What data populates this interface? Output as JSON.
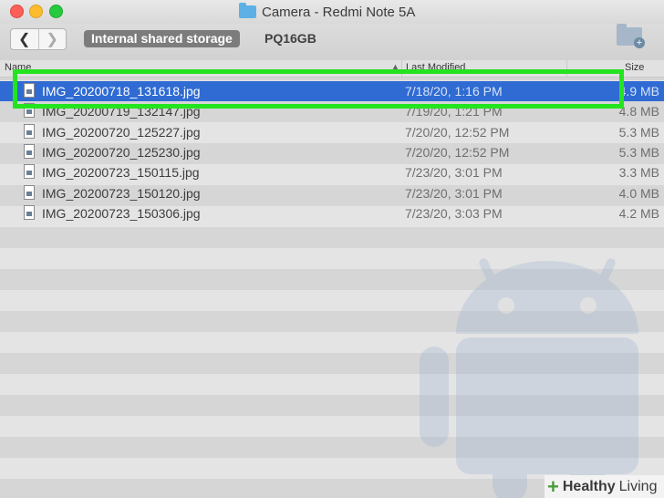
{
  "window": {
    "title": "Camera - Redmi Note 5A",
    "folder_icon": "folder-icon"
  },
  "toolbar": {
    "back_glyph": "❮",
    "forward_glyph": "❯",
    "storage_label": "Internal shared storage",
    "device_label": "PQ16GB",
    "new_folder_icon": "new-folder-icon"
  },
  "columns": {
    "name": "Name",
    "modified": "Last Modified",
    "size": "Size"
  },
  "files": [
    {
      "name": "IMG_20200718_131618.jpg",
      "modified": "7/18/20, 1:16 PM",
      "size": "4.9 MB",
      "selected": true
    },
    {
      "name": "IMG_20200719_132147.jpg",
      "modified": "7/19/20, 1:21 PM",
      "size": "4.8 MB",
      "selected": false
    },
    {
      "name": "IMG_20200720_125227.jpg",
      "modified": "7/20/20, 12:52 PM",
      "size": "5.3 MB",
      "selected": false
    },
    {
      "name": "IMG_20200720_125230.jpg",
      "modified": "7/20/20, 12:52 PM",
      "size": "5.3 MB",
      "selected": false
    },
    {
      "name": "IMG_20200723_150115.jpg",
      "modified": "7/23/20, 3:01 PM",
      "size": "3.3 MB",
      "selected": false
    },
    {
      "name": "IMG_20200723_150120.jpg",
      "modified": "7/23/20, 3:01 PM",
      "size": "4.0 MB",
      "selected": false
    },
    {
      "name": "IMG_20200723_150306.jpg",
      "modified": "7/23/20, 3:03 PM",
      "size": "4.2 MB",
      "selected": false
    }
  ],
  "colors": {
    "selection": "#2f6bd3",
    "highlight_box": "#24e31f",
    "background_watermark": "#9fb4d2"
  },
  "watermark": {
    "icon": "android-robot-icon"
  },
  "badge": {
    "brand": "Healthy",
    "brand2": "Living"
  }
}
